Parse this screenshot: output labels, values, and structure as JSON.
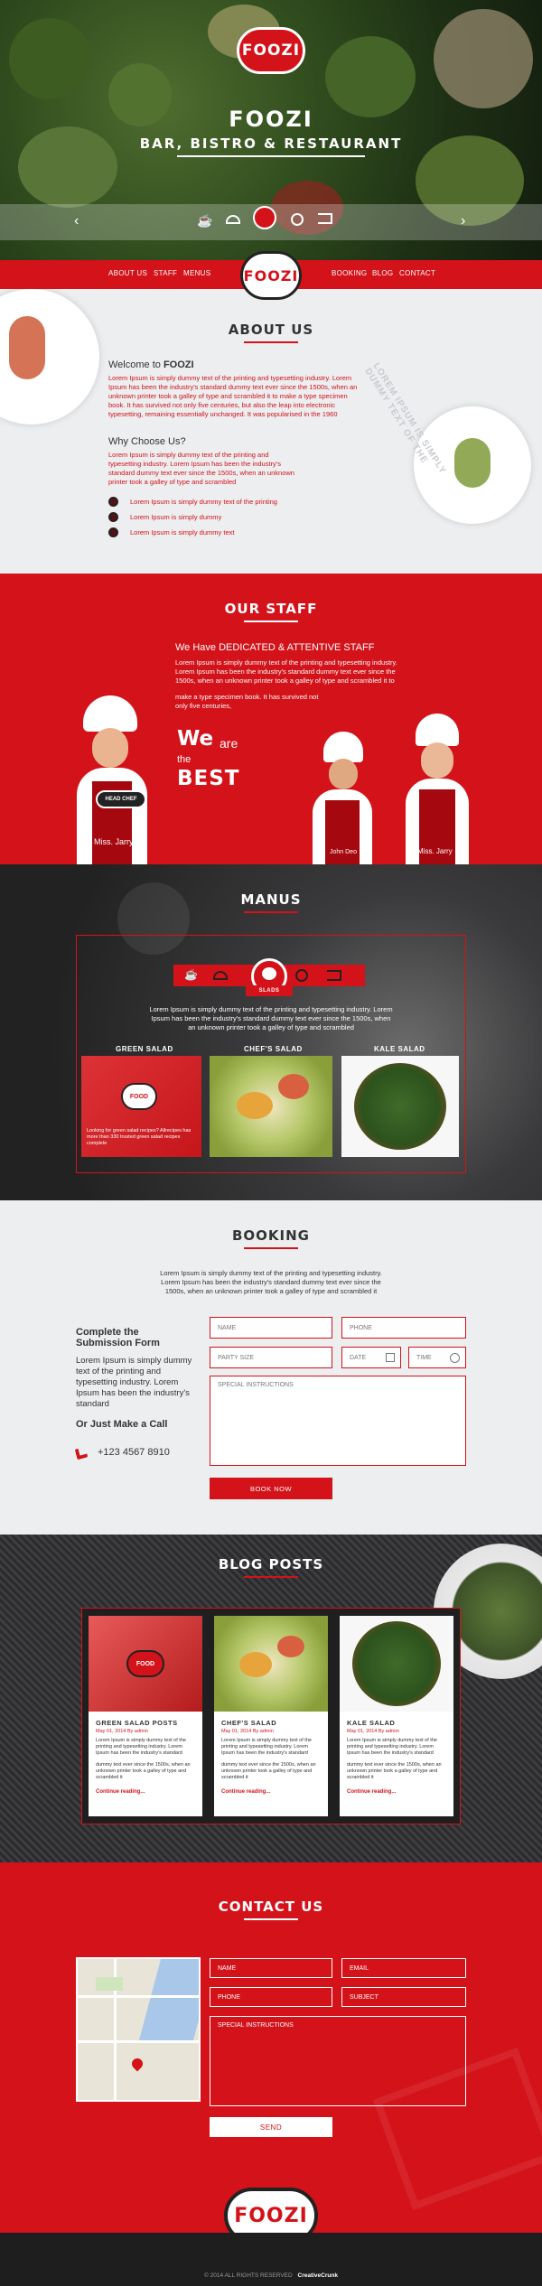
{
  "brand": {
    "logo": "FOOZI",
    "hero_title": "FOOZI",
    "hero_subtitle": "BAR, BISTRO & RESTAURANT"
  },
  "nav": {
    "left": [
      "ABOUT US",
      "STAFF",
      "MENUS"
    ],
    "right": [
      "BOOKING",
      "BLOG",
      "CONTACT"
    ]
  },
  "about": {
    "heading": "ABOUT US",
    "welcome_prefix": "Welcome to ",
    "welcome_brand": "FOOZI",
    "welcome_text": "Lorem Ipsum is simply dummy text of the printing and typesetting industry. Lorem Ipsum has been the industry's standard dummy text ever since the 1500s, when an unknown printer took a galley of type and scrambled it to make a type specimen book. It has survived not only five centuries, but also the leap into electronic typesetting, remaining essentially unchanged. It was popularised in the 1960",
    "why_heading": "Why Choose Us?",
    "why_text": "Lorem Ipsum is simply dummy text of the printing and typesetting industry. Lorem Ipsum has been the industry's standard dummy text ever since the 1500s, when an unknown printer took a galley of type and scrambled",
    "bullets": [
      "Lorem Ipsum is simply dummy text of the printing",
      "Lorem Ipsum is simply dummy",
      "Lorem Ipsum is simply dummy text"
    ],
    "curved_text": "LOREM IPSUM IS SIMPLY DUMMY TEXT OF THE"
  },
  "staff": {
    "heading": "OUR STAFF",
    "subheading": "We Have DEDICATED & ATTENTIVE STAFF",
    "text1": "Lorem Ipsum is simply dummy text of the printing and typesetting industry. Lorem Ipsum has been the industry's standard dummy text ever since the 1500s, when an unknown printer took a galley of type and scrambled it to",
    "text2": "make a type specimen book. It has survived not only five centuries,",
    "we_are": "We",
    "are": "are",
    "the": "the",
    "best": "BEST",
    "head_chef_badge": "HEAD CHEF",
    "members": [
      "Miss. Jarry",
      "John Deo",
      "Miss. Jarry"
    ]
  },
  "menus": {
    "heading": "MANUS",
    "active_tab": "SLADS",
    "text": "Lorem Ipsum is simply dummy text of the printing and typesetting industry. Lorem Ipsum has been the industry's standard dummy text ever since the 1500s, when an unknown printer took a galley of type and scrambled",
    "items": [
      "GREEN SALAD",
      "CHEF'S SALAD",
      "KALE SALAD"
    ],
    "overlay_logo": "FOOD",
    "overlay_text": "Looking for green salad recipes? Allrecipes has more than 330 trusted green salad recipes complete"
  },
  "booking": {
    "heading": "BOOKING",
    "intro": "Lorem Ipsum is simply dummy text of the printing and typesetting industry. Lorem Ipsum has been the industry's standard dummy text ever since the 1500s, when an unknown printer took a galley of type and scrambled it",
    "form_title": "Complete the Submission Form",
    "form_text": "Lorem Ipsum is simply dummy text of the printing and typesetting industry. Lorem Ipsum has been the industry's standard",
    "call_title": "Or Just Make a Call",
    "phone": "+123 4567 8910",
    "fields": {
      "name": "NAME",
      "phone": "PHONE",
      "party": "PARTY SIZE",
      "date": "DATE",
      "time": "TIME",
      "special": "SPECIAL INSTRUCTIONS"
    },
    "submit": "BOOK NOW"
  },
  "blog": {
    "heading": "BLOG POSTS",
    "posts": [
      {
        "title": "GREEN SALAD POSTS",
        "meta": "May 01, 2014 By admin",
        "text1": "Lorem Ipsum is simply dummy text of the printing and typesetting industry. Lorem Ipsum has been the industry's standard",
        "text2": "dummy text ever since the 1500s, when an unknown printer took a galley of type and scrambled it",
        "more": "Continue reading..."
      },
      {
        "title": "CHEF'S SALAD",
        "meta": "May 01, 2014 By admin",
        "text1": "Lorem Ipsum is simply dummy text of the printing and typesetting industry. Lorem Ipsum has been the industry's standard",
        "text2": "dummy text ever since the 1500s, when an unknown printer took a galley of type and scrambled it",
        "more": "Continue reading..."
      },
      {
        "title": "KALE SALAD",
        "meta": "May 01, 2014 By admin",
        "text1": "Lorem Ipsum is simply dummy text of the printing and typesetting industry. Lorem Ipsum has been the industry's standard",
        "text2": "dummy text ever since the 1500s, when an unknown printer took a galley of type and scrambled it",
        "more": "Continue reading..."
      }
    ],
    "card_logo": "FOOD"
  },
  "contact": {
    "heading": "CONTACT US",
    "fields": {
      "name": "NAME",
      "email": "EMAIL",
      "phone": "PHONE",
      "subject": "SUBJECT",
      "special": "SPECIAL INSTRUCTIONS"
    },
    "submit": "SEND"
  },
  "footer": {
    "copyright": "© 2014 ALL RIGHTS RESERVED",
    "credit": "CreativeCrunk"
  },
  "colors": {
    "accent": "#d4121a",
    "dark": "#222222",
    "light": "#eceef0"
  }
}
